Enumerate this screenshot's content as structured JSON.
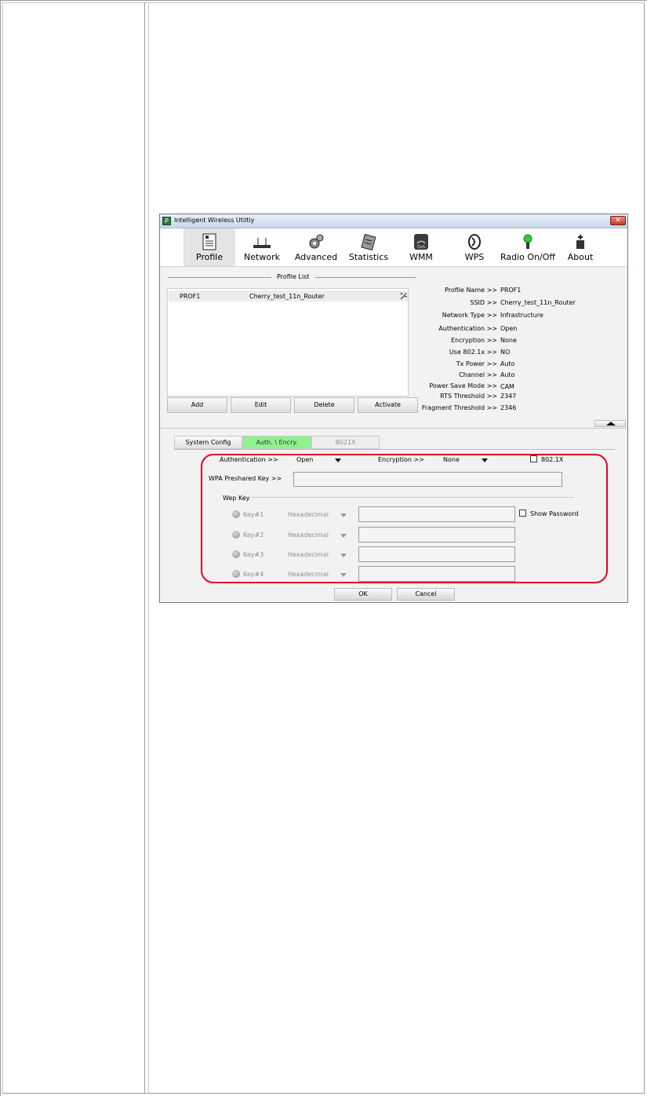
{
  "window": {
    "title": "Intelligent Wireless Utiltiy",
    "close_glyph": "✕"
  },
  "toolbar": [
    {
      "label": "Profile",
      "icon": "profile-icon"
    },
    {
      "label": "Network",
      "icon": "network-icon"
    },
    {
      "label": "Advanced",
      "icon": "advanced-icon"
    },
    {
      "label": "Statistics",
      "icon": "statistics-icon"
    },
    {
      "label": "WMM",
      "icon": "wmm-icon"
    },
    {
      "label": "WPS",
      "icon": "wps-icon"
    },
    {
      "label": "Radio On/Off",
      "icon": "radio-icon"
    },
    {
      "label": "About",
      "icon": "about-icon"
    }
  ],
  "profile_list": {
    "header": "Profile List",
    "rows": [
      {
        "name": "PROF1",
        "ssid": "Cherry_test_11n_Router"
      }
    ],
    "buttons": {
      "add": "Add",
      "edit": "Edit",
      "delete": "Delete",
      "activate": "Activate"
    }
  },
  "info": [
    {
      "label": "Profile Name >>",
      "value": "PROF1"
    },
    {
      "label": "SSID >>",
      "value": "Cherry_test_11n_Router"
    },
    {
      "label": "Network Type >>",
      "value": "Infrastructure"
    },
    {
      "label": "Authentication >>",
      "value": "Open"
    },
    {
      "label": "Encryption >>",
      "value": "None"
    },
    {
      "label": "Use 802.1x >>",
      "value": "NO"
    },
    {
      "label": "Tx Power >>",
      "value": "Auto"
    },
    {
      "label": "Channel >>",
      "value": "Auto"
    },
    {
      "label": "Power Save Mode >>",
      "value": "CAM"
    },
    {
      "label": "RTS Threshold >>",
      "value": "2347"
    },
    {
      "label": "Fragment Threshold >>",
      "value": "2346"
    }
  ],
  "tabs": {
    "system_config": "System Config",
    "auth_encry": "Auth. \\ Encry.",
    "dot1x": "8021X"
  },
  "auth": {
    "authentication_label": "Authentication >>",
    "authentication_value": "Open",
    "encryption_label": "Encryption >>",
    "encryption_value": "None",
    "dot1x_label": "802.1X",
    "wpa_label": "WPA Preshared Key >>",
    "wpa_value": ""
  },
  "wep": {
    "title": "Wep Key",
    "show_password": "Show Password",
    "keys": [
      {
        "label": "Key#1",
        "format": "Hexadecimal",
        "value": ""
      },
      {
        "label": "Key#2",
        "format": "Hexadecimal",
        "value": ""
      },
      {
        "label": "Key#3",
        "format": "Hexadecimal",
        "value": ""
      },
      {
        "label": "Key#4",
        "format": "Hexadecimal",
        "value": ""
      }
    ]
  },
  "dialog": {
    "ok": "OK",
    "cancel": "Cancel"
  },
  "colors": {
    "highlight": "#e4002b",
    "active_tab": "#8ff28f"
  }
}
